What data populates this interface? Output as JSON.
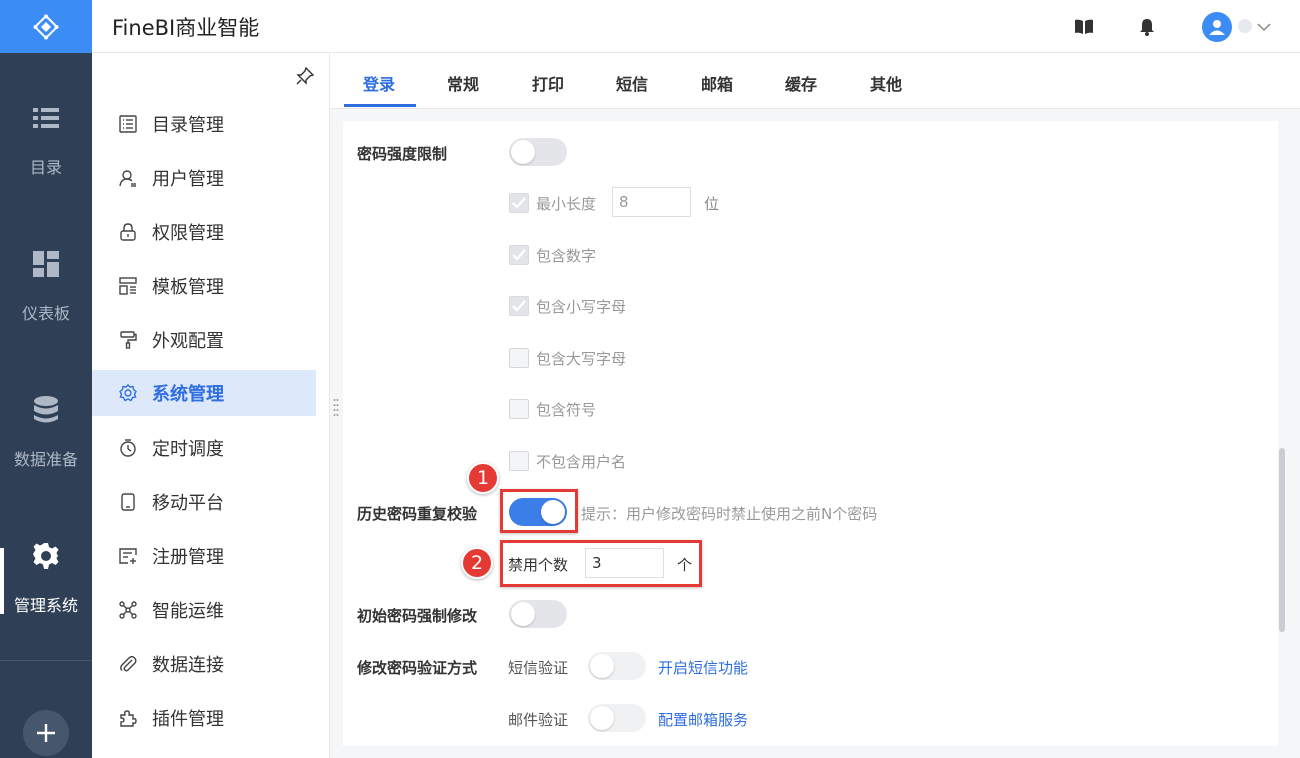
{
  "header": {
    "app_title": "FineBI商业智能"
  },
  "rail": {
    "items": [
      {
        "label": "目录"
      },
      {
        "label": "仪表板"
      },
      {
        "label": "数据准备"
      },
      {
        "label": "管理系统"
      }
    ]
  },
  "menu": {
    "items": [
      {
        "label": "目录管理"
      },
      {
        "label": "用户管理"
      },
      {
        "label": "权限管理"
      },
      {
        "label": "模板管理"
      },
      {
        "label": "外观配置"
      },
      {
        "label": "系统管理"
      },
      {
        "label": "定时调度"
      },
      {
        "label": "移动平台"
      },
      {
        "label": "注册管理"
      },
      {
        "label": "智能运维"
      },
      {
        "label": "数据连接"
      },
      {
        "label": "插件管理"
      }
    ]
  },
  "tabs": [
    {
      "label": "登录"
    },
    {
      "label": "常规"
    },
    {
      "label": "打印"
    },
    {
      "label": "短信"
    },
    {
      "label": "邮箱"
    },
    {
      "label": "缓存"
    },
    {
      "label": "其他"
    }
  ],
  "settings": {
    "password_strength": {
      "label": "密码强度限制",
      "enabled": false,
      "min_length_label": "最小长度",
      "min_length_value": "8",
      "min_length_unit": "位",
      "options": [
        {
          "label": "包含数字",
          "checked": true
        },
        {
          "label": "包含小写字母",
          "checked": true
        },
        {
          "label": "包含大写字母",
          "checked": false
        },
        {
          "label": "包含符号",
          "checked": false
        },
        {
          "label": "不包含用户名",
          "checked": false
        }
      ]
    },
    "history_check": {
      "label": "历史密码重复校验",
      "enabled": true,
      "hint": "提示：用户修改密码时禁止使用之前N个密码",
      "count_label": "禁用个数",
      "count_value": "3",
      "count_unit": "个"
    },
    "initial_force_change": {
      "label": "初始密码强制修改",
      "enabled": false
    },
    "verify_method": {
      "label": "修改密码验证方式",
      "sms_label": "短信验证",
      "sms_link": "开启短信功能",
      "email_label": "邮件验证",
      "email_link": "配置邮箱服务"
    }
  },
  "annotations": {
    "badge1": "1",
    "badge2": "2"
  },
  "colors": {
    "accent": "#2f6ee0",
    "rail": "#2f3f56",
    "logo": "#3c8cf6",
    "highlight": "#e53935"
  }
}
